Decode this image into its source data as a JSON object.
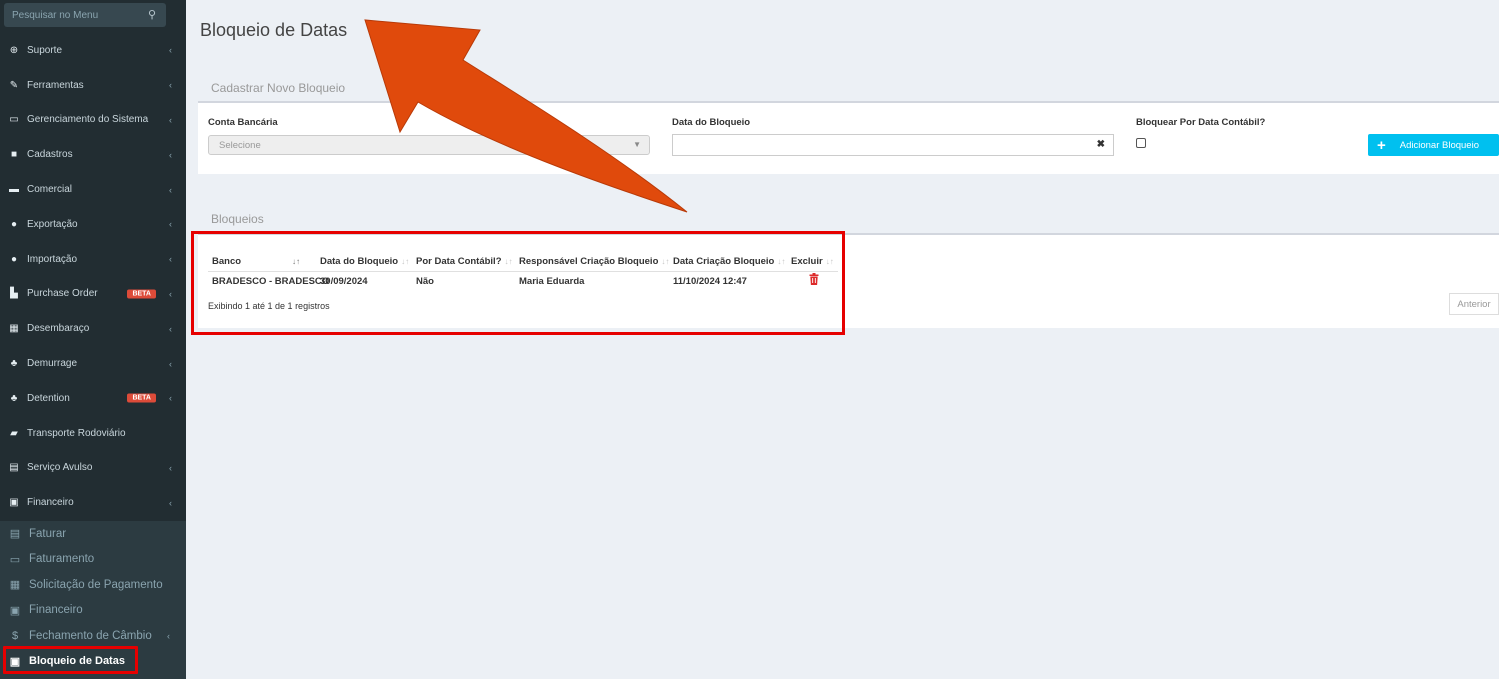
{
  "sidebar": {
    "search_placeholder": "Pesquisar no Menu",
    "items": [
      {
        "label": "Suporte",
        "icon": "globe-icon",
        "glyph": "⊕"
      },
      {
        "label": "Ferramentas",
        "icon": "wrench-icon",
        "glyph": "✎"
      },
      {
        "label": "Gerenciamento do Sistema",
        "icon": "laptop-icon",
        "glyph": "▭"
      },
      {
        "label": "Cadastros",
        "icon": "book-icon",
        "glyph": "■"
      },
      {
        "label": "Comercial",
        "icon": "briefcase-icon",
        "glyph": "▬"
      },
      {
        "label": "Exportação",
        "icon": "arrow-circle-up-icon",
        "glyph": "●"
      },
      {
        "label": "Importação",
        "icon": "arrow-circle-down-icon",
        "glyph": "●"
      },
      {
        "label": "Purchase Order",
        "icon": "bar-chart-icon",
        "glyph": "▙",
        "badge": "BETA"
      },
      {
        "label": "Desembaraço",
        "icon": "calculator-icon",
        "glyph": "▦"
      },
      {
        "label": "Demurrage",
        "icon": "cubes-icon",
        "glyph": "♣"
      },
      {
        "label": "Detention",
        "icon": "cubes-icon",
        "glyph": "♣",
        "badge": "BETA"
      },
      {
        "label": "Transporte Rodoviário",
        "icon": "truck-icon",
        "glyph": "▰"
      },
      {
        "label": "Serviço Avulso",
        "icon": "file-icon",
        "glyph": "▤"
      },
      {
        "label": "Financeiro",
        "icon": "money-icon",
        "glyph": "▣"
      }
    ],
    "submenu": [
      {
        "label": "Faturar",
        "icon": "file-text-icon",
        "glyph": "▤"
      },
      {
        "label": "Faturamento",
        "icon": "credit-card-icon",
        "glyph": "▭"
      },
      {
        "label": "Solicitação de Pagamento",
        "icon": "calculator-icon",
        "glyph": "▦"
      },
      {
        "label": "Financeiro",
        "icon": "money-icon",
        "glyph": "▣"
      },
      {
        "label": "Fechamento de Câmbio",
        "icon": "dollar-icon",
        "glyph": "$"
      },
      {
        "label": "Bloqueio de Datas",
        "icon": "calendar-icon",
        "glyph": "▣"
      }
    ]
  },
  "page": {
    "title": "Bloqueio de Datas"
  },
  "form": {
    "section_title": "Cadastrar Novo Bloqueio",
    "conta_label": "Conta Bancária",
    "conta_value": "Selecione",
    "data_label": "Data do Bloqueio",
    "data_value": "",
    "contabil_label": "Bloquear Por Data Contábil?",
    "add_button": "Adicionar Bloqueio"
  },
  "table": {
    "section_title": "Bloqueios",
    "columns": [
      "Banco",
      "Data do Bloqueio",
      "Por Data Contábil?",
      "Responsável Criação Bloqueio",
      "Data Criação Bloqueio",
      "Excluir"
    ],
    "rows": [
      [
        "BRADESCO - BRADESCO",
        "30/09/2024",
        "Não",
        "Maria Eduarda",
        "11/10/2024 12:47"
      ]
    ],
    "info": "Exibindo 1 até 1 de 1 registros",
    "prev_button": "Anterior"
  },
  "colors": {
    "sidebar_bg": "#222d32",
    "accent_button": "#00c0ef",
    "highlight": "#e60000",
    "arrow": "#e04a0c"
  }
}
